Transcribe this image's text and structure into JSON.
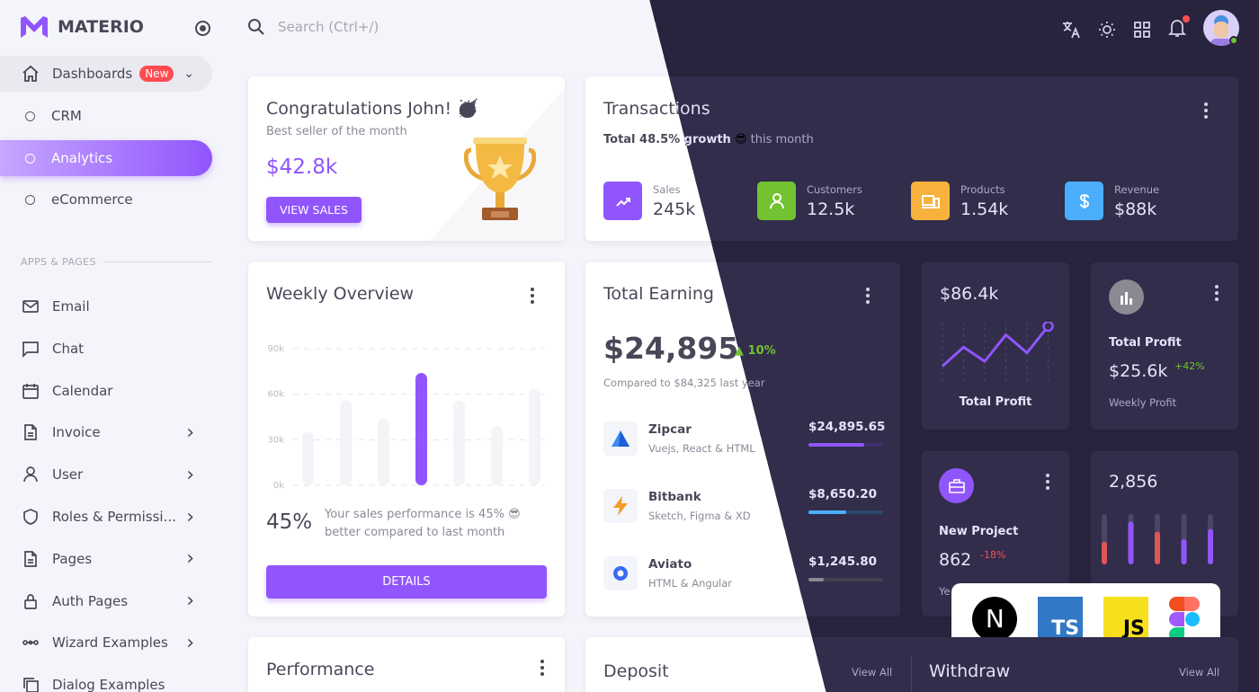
{
  "brand": {
    "name": "MATERIO",
    "color": "#9155fd"
  },
  "search": {
    "placeholder": "Search (Ctrl+/)"
  },
  "topbar": {
    "icons": [
      "translate-icon",
      "sun-icon",
      "grid-icon",
      "bell-icon"
    ],
    "notification_dot": true
  },
  "sidebar": {
    "dashboards": {
      "label": "Dashboards",
      "badge": "New"
    },
    "sub": [
      {
        "label": "CRM"
      },
      {
        "label": "Analytics",
        "active": true
      },
      {
        "label": "eCommerce"
      }
    ],
    "section": "APPS & PAGES",
    "items": [
      {
        "label": "Email",
        "icon": "mail-icon",
        "chevron": false
      },
      {
        "label": "Chat",
        "icon": "chat-icon",
        "chevron": false
      },
      {
        "label": "Calendar",
        "icon": "calendar-icon",
        "chevron": false
      },
      {
        "label": "Invoice",
        "icon": "file-icon",
        "chevron": true
      },
      {
        "label": "User",
        "icon": "user-icon",
        "chevron": true
      },
      {
        "label": "Roles & Permissi...",
        "icon": "shield-icon",
        "chevron": true
      },
      {
        "label": "Pages",
        "icon": "file-icon",
        "chevron": true
      },
      {
        "label": "Auth Pages",
        "icon": "lock-icon",
        "chevron": true
      },
      {
        "label": "Wizard Examples",
        "icon": "dots-icon",
        "chevron": true
      },
      {
        "label": "Dialog Examples",
        "icon": "copy-icon",
        "chevron": false
      }
    ]
  },
  "congrats": {
    "title": "Congratulations John! 🥳",
    "subtitle": "Best seller of the month",
    "amount": "$42.8k",
    "button": "VIEW SALES"
  },
  "transactions": {
    "title": "Transactions",
    "growth_bold": "Total 48.5% growth",
    "growth_emoji": "😎",
    "growth_rest": " this month",
    "stats": [
      {
        "label": "Sales",
        "value": "245k",
        "color": "#9155fd",
        "icon": "trending-up-icon"
      },
      {
        "label": "Customers",
        "value": "12.5k",
        "color": "#72c232",
        "icon": "user-icon"
      },
      {
        "label": "Products",
        "value": "1.54k",
        "color": "#f6b23c",
        "icon": "devices-icon"
      },
      {
        "label": "Revenue",
        "value": "$88k",
        "color": "#4aaefc",
        "icon": "dollar-icon"
      }
    ]
  },
  "weekly": {
    "title": "Weekly Overview",
    "percent": "45%",
    "text1": "Your sales performance is 45% 😎",
    "text2": "better compared to last month",
    "button": "DETAILS"
  },
  "chart_data": [
    {
      "type": "bar",
      "title": "Weekly Overview",
      "ylim": [
        0,
        90000
      ],
      "yticks": [
        "0k",
        "30k",
        "60k",
        "90k"
      ],
      "values": [
        35000,
        56000,
        44000,
        74000,
        56000,
        39000,
        64000
      ],
      "highlight_index": 3,
      "grid": true
    },
    {
      "type": "line",
      "title": "Total Profit",
      "values": [
        10,
        30,
        15,
        43,
        24,
        52
      ],
      "color": "#9155fd"
    },
    {
      "type": "bar",
      "title": "2,856",
      "values": [
        0.45,
        0.85,
        0.65,
        0.5,
        0.7
      ],
      "colors": [
        "#e05656",
        "#9155fd",
        "#e05656",
        "#9155fd",
        "#9155fd"
      ]
    }
  ],
  "earning": {
    "title": "Total Earning",
    "amount": "$24,895",
    "change": "10%",
    "compare": "Compared to $84,325 last year",
    "rows": [
      {
        "name": "Zipcar",
        "sub": "Vuejs, React & HTML",
        "amount": "$24,895.65",
        "progress": 75,
        "color": "#9155fd",
        "track": "#3f2f6e"
      },
      {
        "name": "Bitbank",
        "sub": "Sketch, Figma & XD",
        "amount": "$8,650.20",
        "progress": 50,
        "color": "#4aaefc",
        "track": "#2b4a6b"
      },
      {
        "name": "Aviato",
        "sub": "HTML & Angular",
        "amount": "$1,245.80",
        "progress": 20,
        "color": "#8a8a92",
        "track": "#44414d"
      }
    ]
  },
  "profit_chart": {
    "value": "$86.4k",
    "label": "Total Profit"
  },
  "total_profit": {
    "title": "Total Profit",
    "value": "$25.6k",
    "change": "+42%",
    "sub": "Weekly Profit"
  },
  "new_project": {
    "title": "New Project",
    "value": "862",
    "change": "-18%",
    "sub": "Ye"
  },
  "bars_card": {
    "value": "2,856"
  },
  "tech": [
    "Next.js",
    "TS",
    "JS",
    "Figma"
  ],
  "performance": {
    "title": "Performance"
  },
  "deposit": {
    "title": "Deposit",
    "view_all": "View All"
  },
  "withdraw": {
    "title": "Withdraw",
    "view_all": "View All"
  }
}
